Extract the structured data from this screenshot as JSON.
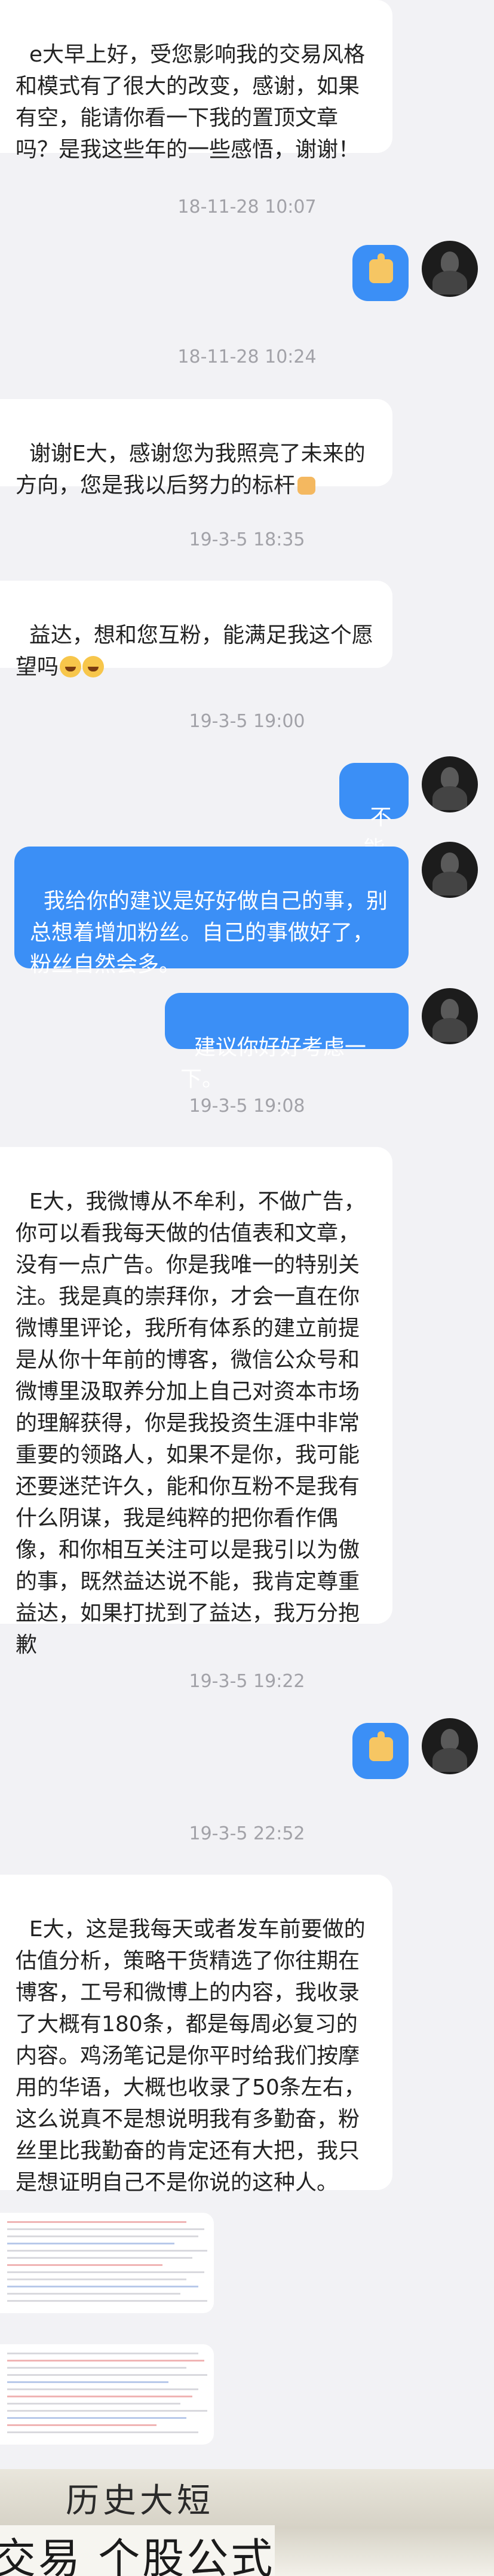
{
  "messages": {
    "m1": "e大早上好，受您影响我的交易风格和模式有了很大的改变，感谢，如果有空，能请你看一下我的置顶文章吗？是我这些年的一些感悟，谢谢！",
    "m2": "谢谢E大，感谢您为我照亮了未来的方向，您是我以后努力的标杆",
    "m3": "益达，想和您互粉，能满足我这个愿望吗",
    "m4": "不能",
    "m5": "我给你的建议是好好做自己的事，别总想着增加粉丝。自己的事做好了，粉丝自然会多。",
    "m6": "建议你好好考虑一下。",
    "m7": "E大，我微博从不牟利，不做广告，你可以看我每天做的估值表和文章，没有一点广告。你是我唯一的特别关注。我是真的崇拜你，才会一直在你微博里评论，我所有体系的建立前提是从你十年前的博客，微信公众号和微博里汲取养分加上自己对资本市场的理解获得，你是我投资生涯中非常重要的领路人，如果不是你，我可能还要迷茫许久，能和你互粉不是我有什么阴谋，我是纯粹的把你看作偶像，和你相互关注可以是我引以为傲的事，既然益达说不能，我肯定尊重益达，如果打扰到了益达，我万分抱歉",
    "m8": "E大，这是我每天或者发车前要做的估值分析，策略干货精选了你往期在博客，工号和微博上的内容，我收录了大概有180条，都是每周必复习的内容。鸡汤笔记是你平时给我们按摩用的华语，大概也收录了50条左右，这么说真不是想说明我有多勤奋，粉丝里比我勤奋的肯定还有大把，我只是想证明自己不是你说的这种人。"
  },
  "timestamps": {
    "t1": "18-11-28 10:07",
    "t2": "18-11-28 10:24",
    "t3": "19-3-5 18:35",
    "t4": "19-3-5 19:00",
    "t5": "19-3-5 19:08",
    "t6": "19-3-5 19:22",
    "t7": "19-3-5 22:52"
  },
  "banner": {
    "top_text": "历史大短",
    "bottom_text": "交易  个股公式"
  },
  "colors": {
    "background": "#f2f2f5",
    "outgoing_bubble": "#3b8ff6",
    "incoming_bubble": "#ffffff",
    "timestamp": "#a2a2a8"
  },
  "icons": {
    "thumbs_up": "thumbs-up-icon",
    "laugh": "laughing-emoji-icon",
    "fist": "fist-emoji-icon"
  }
}
